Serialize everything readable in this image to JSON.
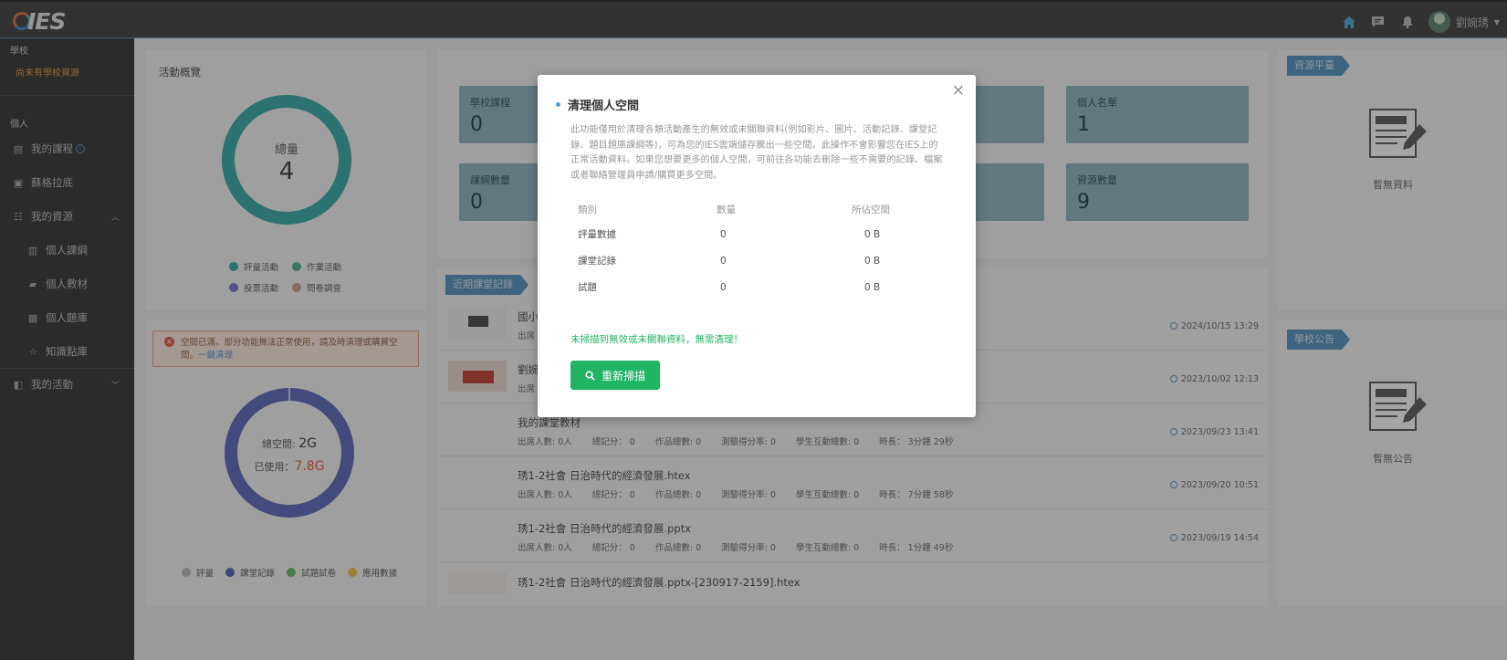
{
  "header": {
    "logo_text": "IES",
    "user_name": "劉婉琇"
  },
  "sidebar": {
    "school_section": "學校",
    "school_empty": "尚未有學校資源",
    "personal_section": "個人",
    "items": [
      {
        "label": "我的課程"
      },
      {
        "label": "蘇格拉底"
      },
      {
        "label": "我的資源"
      },
      {
        "label": "個人課綱"
      },
      {
        "label": "個人教材"
      },
      {
        "label": "個人題庫"
      },
      {
        "label": "知識點庫"
      },
      {
        "label": "我的活動"
      }
    ]
  },
  "activity": {
    "title": "活動概覽",
    "center_label": "總量",
    "center_value": "4",
    "legend": [
      {
        "label": "評量活動",
        "color": "#2fa7a0"
      },
      {
        "label": "作業活動",
        "color": "#3fb08c"
      },
      {
        "label": "投票活動",
        "color": "#6b72c8"
      },
      {
        "label": "問卷調查",
        "color": "#c99a8a"
      }
    ]
  },
  "storage": {
    "alert": "空間已滿，部分功能無法正常使用，請及時清理或購買空間。",
    "alert_link": "一鍵清理",
    "total_label": "總空間:",
    "total_value": "2G",
    "used_label": "已使用：",
    "used_value": "7.8G",
    "legend": [
      {
        "label": "評量",
        "color": "#b9b9b9"
      },
      {
        "label": "課堂記錄",
        "color": "#4d5fb5"
      },
      {
        "label": "試題試卷",
        "color": "#5cb85c"
      },
      {
        "label": "應用數據",
        "color": "#f0c040"
      }
    ]
  },
  "stats": [
    {
      "label": "學校課程",
      "value": "0"
    },
    {
      "label": "個人名單",
      "value": "1"
    },
    {
      "label": "課綱數量",
      "value": "0"
    },
    {
      "label": "資源數量",
      "value": "9"
    }
  ],
  "recent": {
    "title": "近期課堂記錄",
    "rows": [
      {
        "title": "國小",
        "time": "2024/10/15 13:29",
        "meta": []
      },
      {
        "title": "劉婉",
        "time": "2023/10/02 12:13",
        "meta": []
      },
      {
        "title": "我的課堂教材",
        "time": "2023/09/23 13:41",
        "meta": [
          "出席人數: 0人",
          "總記分： 0",
          "作品總數: 0",
          "測驗得分率: 0",
          "學生互動總數: 0",
          "時長： 3分鐘 29秒"
        ]
      },
      {
        "title": "琇1-2社會 日治時代的經濟發展.htex",
        "time": "2023/09/20 10:51",
        "meta": [
          "出席人數: 0人",
          "總記分： 0",
          "作品總數: 0",
          "測驗得分率: 0",
          "學生互動總數: 0",
          "時長： 7分鐘 58秒"
        ]
      },
      {
        "title": "琇1-2社會 日治時代的經濟發展.pptx",
        "time": "2023/09/19 14:54",
        "meta": [
          "出席人數: 0人",
          "總記分： 0",
          "作品總數: 0",
          "測驗得分率: 0",
          "學生互動總數: 0",
          "時長： 1分鐘 49秒"
        ]
      },
      {
        "title": "琇1-2社會 日治時代的經濟發展.pptx-[230917-2159].htex",
        "time": "",
        "meta": []
      }
    ],
    "partial_meta": "出席"
  },
  "right": {
    "resource_title": "資源平臺",
    "resource_empty": "暫無資料",
    "notice_title": "學校公告",
    "notice_empty": "暫無公告"
  },
  "modal": {
    "title": "清理個人空間",
    "description": "此功能僅用於清理各類活動產生的無效或未關聯資料(例如影片、圖片、活動記錄、課堂記錄、題目題庫課綱等)，可為您的IES雲端儲存騰出一些空間。此操作不會影響您在IES上的正常活動資料。如果您想要更多的個人空間，可前往各功能去刪除一些不需要的記錄、檔案或者聯絡管理員申請/購買更多空間。",
    "columns": [
      "類別",
      "數量",
      "所佔空間"
    ],
    "rows": [
      [
        "評量數據",
        "0",
        "0 B"
      ],
      [
        "課堂記錄",
        "0",
        "0 B"
      ],
      [
        "試題",
        "0",
        "0 B"
      ]
    ],
    "result": "未掃描到無效或未關聯資料，無需清理！",
    "rescan": "重新掃描"
  }
}
